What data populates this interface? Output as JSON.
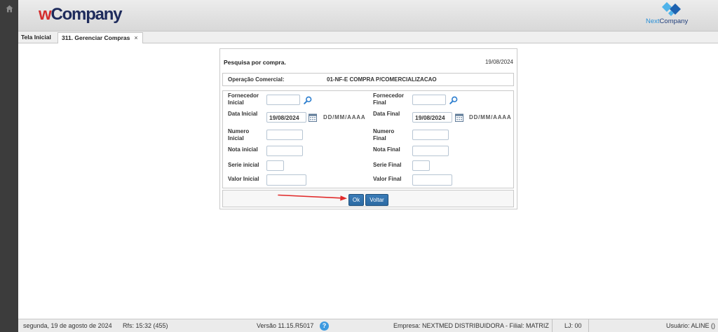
{
  "header": {
    "logo": {
      "prefix": "w",
      "name": "Company"
    },
    "partner_logo": {
      "prefix": "Next",
      "name": "Company"
    }
  },
  "sidebar": {
    "icon": "home-icon"
  },
  "tabs": [
    {
      "label": "Tela Inicial",
      "active": false
    },
    {
      "label": "311. Gerenciar Compras",
      "active": true,
      "close": "×"
    }
  ],
  "form": {
    "title": "Pesquisa por compra.",
    "date": "19/08/2024",
    "operation_label": "Operação Comercial:",
    "operation_value": "01-NF-E COMPRA P/COMERCIALIZACAO",
    "date_hint": "DD/MM/AAAA",
    "fields": {
      "fornecedor_inicial": {
        "label": "Fornecedor Inicial",
        "value": ""
      },
      "fornecedor_final": {
        "label": "Fornecedor Final",
        "value": ""
      },
      "data_inicial": {
        "label": "Data Inicial",
        "value": "19/08/2024"
      },
      "data_final": {
        "label": "Data Final",
        "value": "19/08/2024"
      },
      "numero_inicial": {
        "label": "Numero Inicial",
        "value": ""
      },
      "numero_final": {
        "label": "Numero Final",
        "value": ""
      },
      "nota_inicial": {
        "label": "Nota inicial",
        "value": ""
      },
      "nota_final": {
        "label": "Nota Final",
        "value": ""
      },
      "serie_inicial": {
        "label": "Serie inicial",
        "value": ""
      },
      "serie_final": {
        "label": "Serie Final",
        "value": ""
      },
      "valor_inicial": {
        "label": "Valor Inicial",
        "value": ""
      },
      "valor_final": {
        "label": "Valor Final",
        "value": ""
      }
    },
    "buttons": {
      "ok": "Ok",
      "back": "Voltar"
    }
  },
  "status_bar": {
    "date": "segunda, 19 de agosto de 2024",
    "refresh": "Rfs: 15:32 (455)",
    "version": "Versão 11.15.R5017",
    "help": "?",
    "company": "Empresa: NEXTMED DISTRIBUIDORA - Filial: MATRIZ",
    "store": "LJ: 00",
    "user": "Usuário: ALINE ()"
  },
  "icons": {
    "home": "home-icon",
    "search": "search-icon",
    "calendar": "calendar-icon",
    "help": "help-icon",
    "close": "close-icon"
  },
  "colors": {
    "logo_red": "#d42e2e",
    "logo_navy": "#1e2b5c",
    "button_blue": "#2c6aa3",
    "help_blue": "#3d9ae0",
    "annotation_red": "#e12a2a"
  }
}
